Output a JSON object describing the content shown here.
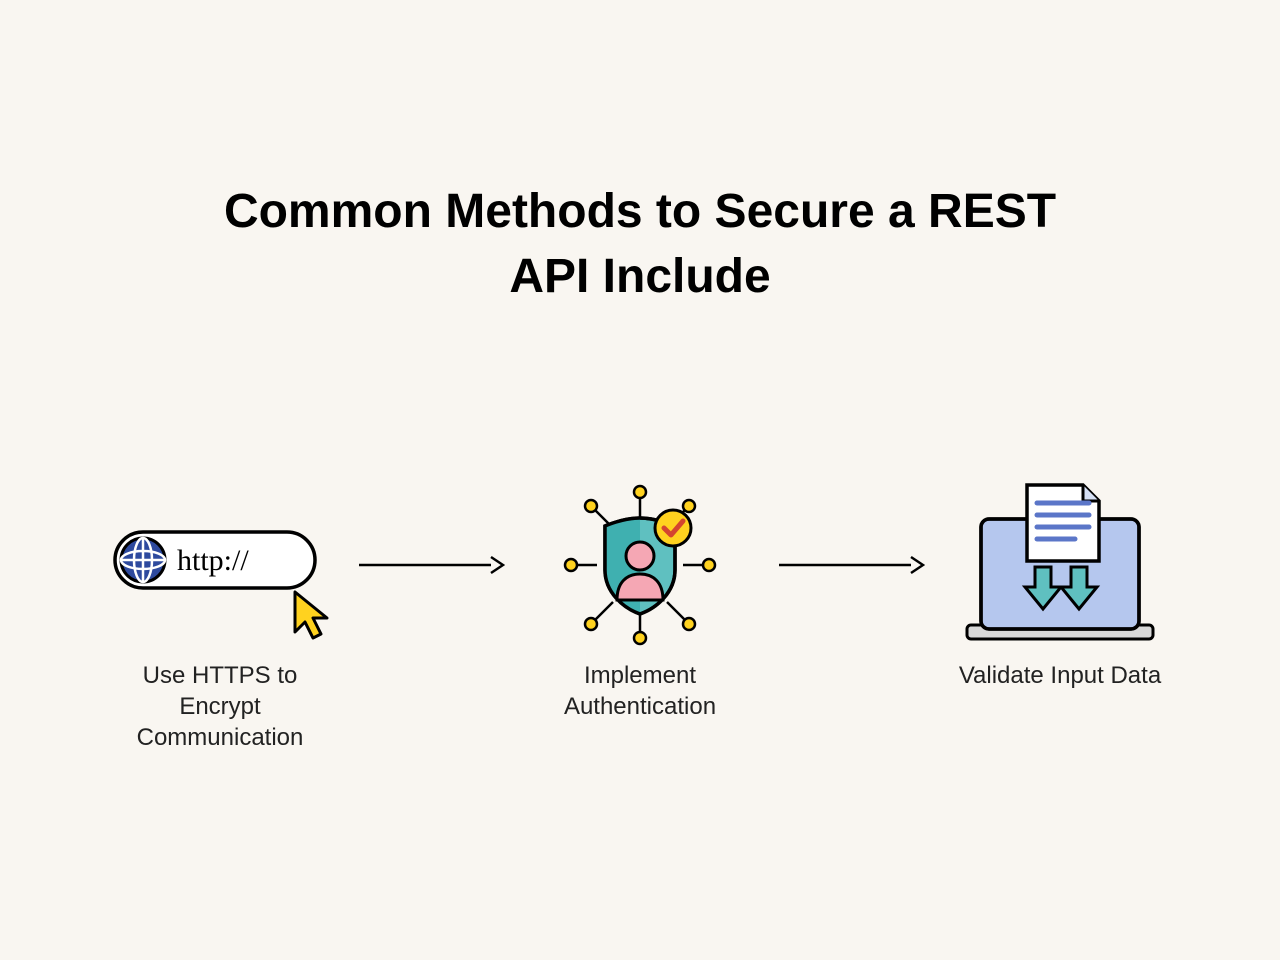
{
  "title": "Common Methods to Secure a REST API Include",
  "items": [
    {
      "icon": "http-icon",
      "label": "Use HTTPS to Encrypt Communication",
      "badge_text": "http://"
    },
    {
      "icon": "auth-icon",
      "label": "Implement Authentication"
    },
    {
      "icon": "validate-icon",
      "label": "Validate Input Data"
    }
  ],
  "colors": {
    "accent_blue": "#2e4a9e",
    "accent_teal": "#5fc0c0",
    "accent_yellow": "#ffd21f",
    "accent_pink": "#f5a7b4",
    "accent_lightblue": "#b5c7ee"
  }
}
